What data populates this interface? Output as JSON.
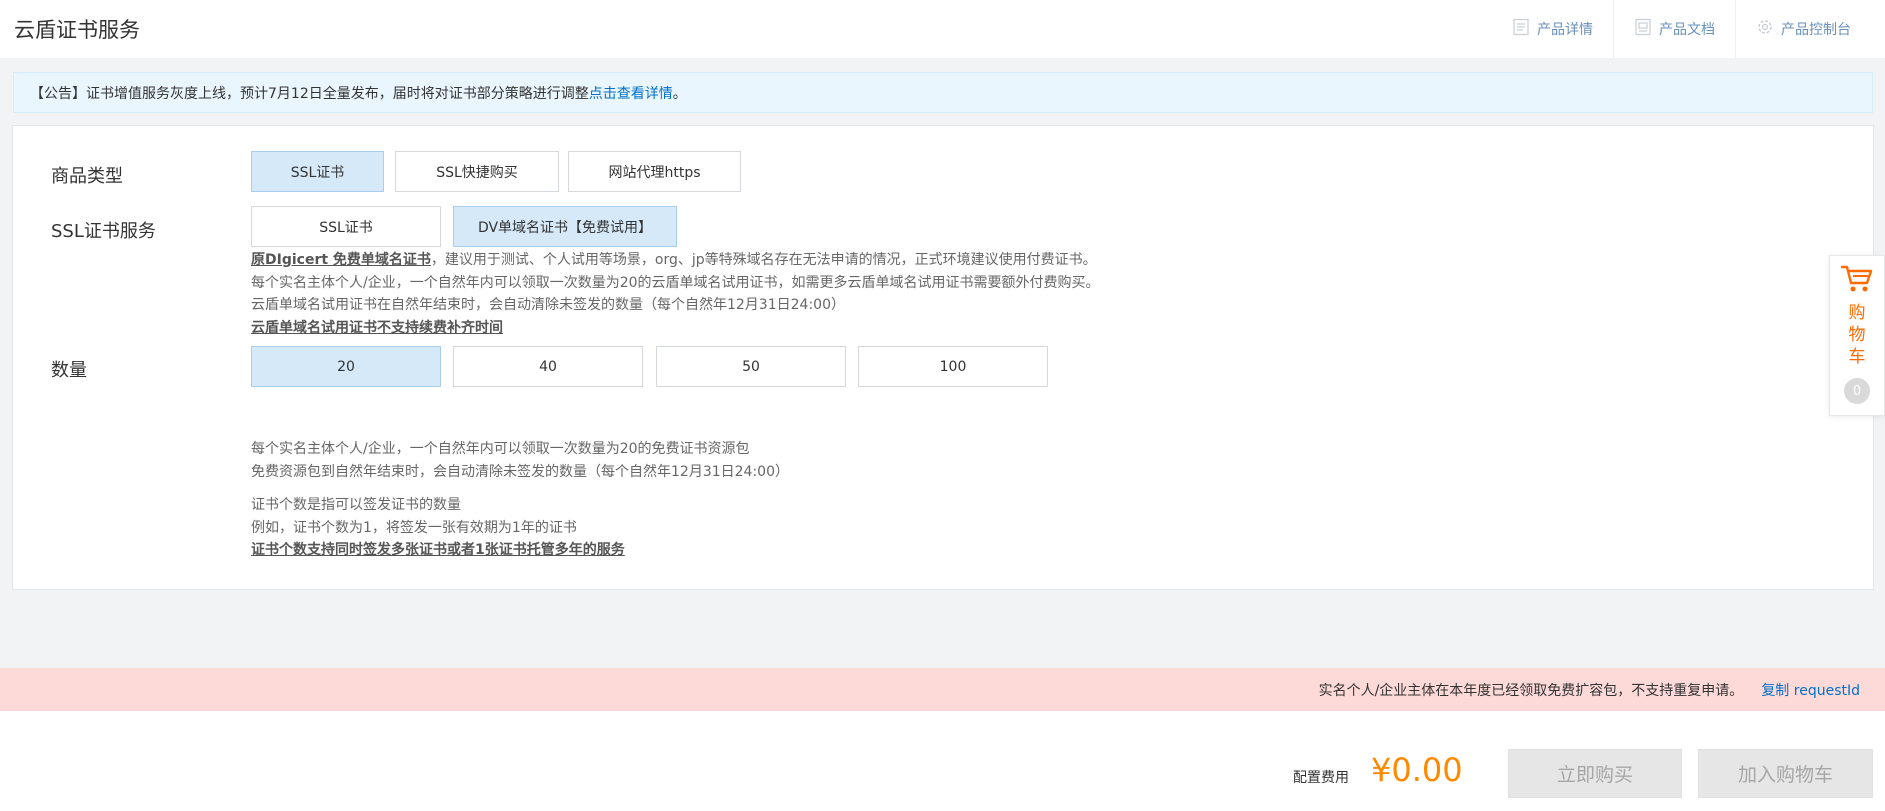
{
  "header": {
    "title": "云盾证书服务",
    "links": [
      {
        "label": "产品详情",
        "icon": "document-list-icon"
      },
      {
        "label": "产品文档",
        "icon": "doc-icon"
      },
      {
        "label": "产品控制台",
        "icon": "gear-icon"
      }
    ]
  },
  "notice": {
    "text": "【公告】证书增值服务灰度上线，预计7月12日全量发布，届时将对证书部分策略进行调整",
    "link": "点击查看详情",
    "suffix": "。"
  },
  "product_type": {
    "label": "商品类型",
    "options": [
      "SSL证书",
      "SSL快捷购买",
      "网站代理https"
    ],
    "selected": "SSL证书"
  },
  "ssl_service": {
    "label": "SSL证书服务",
    "options": [
      "SSL证书",
      "DV单域名证书【免费试用】"
    ],
    "selected": "DV单域名证书【免费试用】",
    "desc_bold": "原DIgicert 免费单域名证书",
    "desc_line1": "，建议用于测试、个人试用等场景，org、jp等特殊域名存在无法申请的情况，正式环境建议使用付费证书。",
    "desc_line2": "每个实名主体个人/企业，一个自然年内可以领取一次数量为20的云盾单域名试用证书，如需更多云盾单域名试用证书需要额外付费购买。",
    "desc_line3": "云盾单域名试用证书在自然年结束时，会自动清除未签发的数量（每个自然年12月31日24:00）",
    "desc_line4": "云盾单域名试用证书不支持续费补齐时间"
  },
  "quantity": {
    "label": "数量",
    "options": [
      "20",
      "40",
      "50",
      "100"
    ],
    "selected": "20",
    "desc_line1": "每个实名主体个人/企业，一个自然年内可以领取一次数量为20的免费证书资源包",
    "desc_line2": "免费资源包到自然年结束时，会自动清除未签发的数量（每个自然年12月31日24:00）",
    "desc_line3": "证书个数是指可以签发证书的数量",
    "desc_line4": "例如，证书个数为1，将签发一张有效期为1年的证书",
    "desc_line5": "证书个数支持同时签发多张证书或者1张证书托管多年的服务"
  },
  "cart": {
    "label": "购物车",
    "count": "0",
    "icon": "shopping-cart-icon"
  },
  "error": {
    "message": "实名个人/企业主体在本年度已经领取免费扩容包，不支持重复申请。",
    "copy": "复制 requestId"
  },
  "footer": {
    "fee_label": "配置费用",
    "fee_value": "¥0.00",
    "buy_now": "立即购买",
    "add_to_cart": "加入购物车"
  },
  "colors": {
    "accent": "#0070cc",
    "price": "#ff8a00",
    "selected_bg": "#d6e9f8",
    "error_bg": "#fdd9d7"
  }
}
